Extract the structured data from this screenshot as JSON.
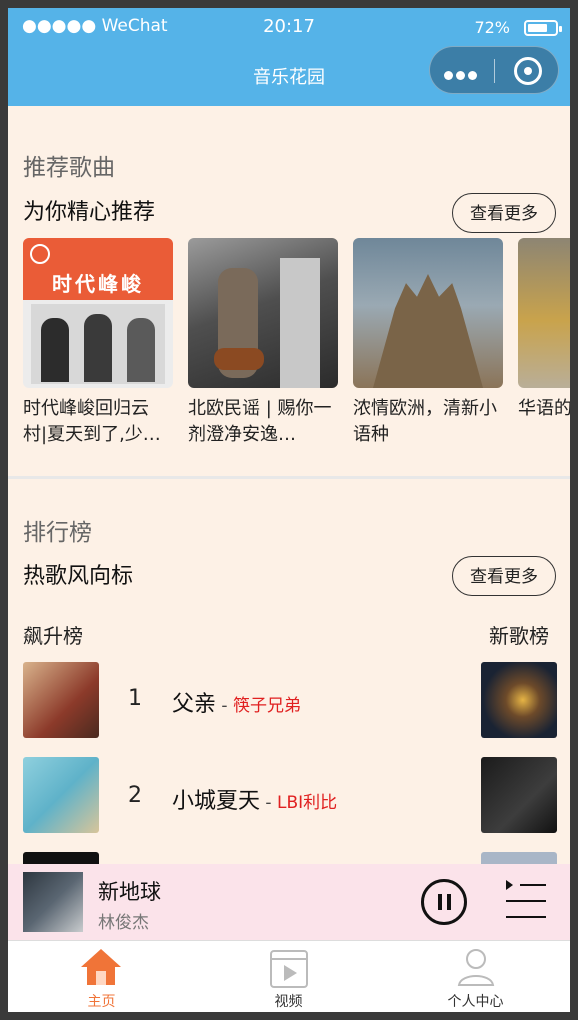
{
  "status": {
    "carrier": "●●●●● WeChat",
    "time": "20:17",
    "battery": "72%",
    "battery_level": 0.72
  },
  "nav": {
    "title": "音乐花园"
  },
  "recommend": {
    "title": "推荐歌曲",
    "subtitle": "为你精心推荐",
    "more": "查看更多",
    "cards": [
      {
        "title": "时代峰峻回归云村|夏天到了,少…",
        "cover_text": "时代峰峻"
      },
      {
        "title": "北欧民谣 | 赐你一剂澄净安逸…"
      },
      {
        "title": "浓情欧洲，清新小语种"
      },
      {
        "title": "华语的心"
      }
    ]
  },
  "charts": {
    "title": "排行榜",
    "subtitle": "热歌风向标",
    "more": "查看更多",
    "left_label": "飙升榜",
    "right_label": "新歌榜",
    "rows": [
      {
        "rank": "1",
        "song": "父亲",
        "artist": "筷子兄弟"
      },
      {
        "rank": "2",
        "song": "小城夏天",
        "artist": "LBI利比"
      }
    ]
  },
  "player": {
    "song": "新地球",
    "singer": "林俊杰"
  },
  "tabs": [
    {
      "label": "主页"
    },
    {
      "label": "视频"
    },
    {
      "label": "个人中心"
    }
  ],
  "colors": {
    "accent": "#55b3e8",
    "tab_active": "#f07438",
    "artist": "#e02020"
  }
}
